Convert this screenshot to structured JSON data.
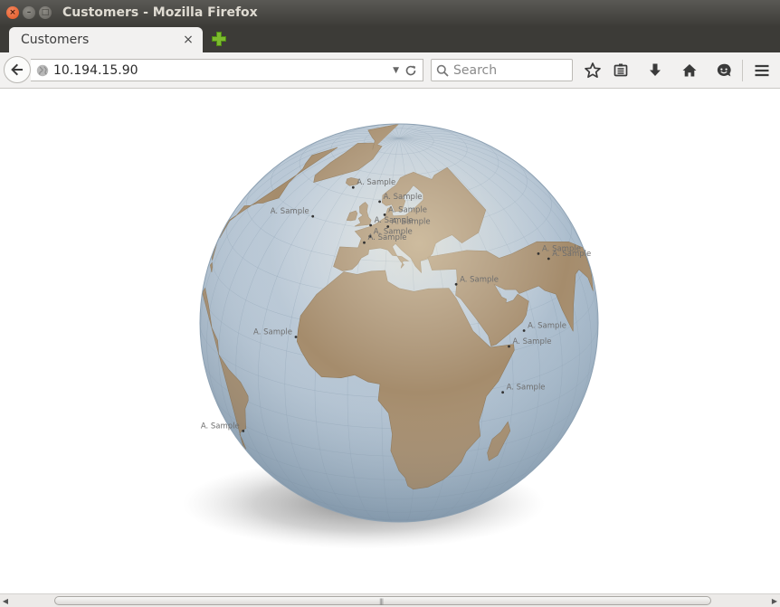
{
  "window": {
    "title": "Customers - Mozilla Firefox",
    "close_glyph": "×",
    "minimize_glyph": "–",
    "maximize_glyph": "□"
  },
  "tabs": [
    {
      "label": "Customers",
      "close_glyph": "×",
      "active": true
    }
  ],
  "navbar": {
    "url": "10.194.15.90",
    "url_dropdown_glyph": "▼",
    "search_placeholder": "Search",
    "icons": [
      "back-arrow-icon",
      "globe-icon",
      "reload-icon",
      "search-icon",
      "bookmark-star-icon",
      "reading-list-icon",
      "download-icon",
      "home-icon",
      "smiley-icon",
      "hamburger-menu-icon"
    ]
  },
  "map": {
    "type": "orthographic-globe",
    "land_color": "#a58c6c",
    "ocean_color": "#b3c4d3",
    "marker_color": "#333333",
    "markers": [
      {
        "label": "A. Sample",
        "lon": -15.6,
        "lat": 63.1
      },
      {
        "label": "A. Sample",
        "lon": -27.6,
        "lat": 50.2
      },
      {
        "label": "A. Sample",
        "lon": 4.0,
        "lat": 59.3
      },
      {
        "label": "A. Sample",
        "lon": 7.8,
        "lat": 54.8
      },
      {
        "label": "A. Sample",
        "lon": 1.9,
        "lat": 51.0
      },
      {
        "label": "A. Sample",
        "lon": 9.9,
        "lat": 50.9
      },
      {
        "label": "A. Sample",
        "lon": 2.5,
        "lat": 47.4
      },
      {
        "label": "A. Sample",
        "lon": 0.6,
        "lat": 45.3
      },
      {
        "label": "A. Sample",
        "lon": 34.8,
        "lat": 32.1
      },
      {
        "label": "A. Sample",
        "lon": 72.4,
        "lat": 33.8
      },
      {
        "label": "A. Sample",
        "lon": 76.2,
        "lat": 31.0
      },
      {
        "label": "A. Sample",
        "lon": 55.5,
        "lat": 14.8
      },
      {
        "label": "A. Sample",
        "lon": 49.3,
        "lat": 11.5
      },
      {
        "label": "A. Sample",
        "lon": 46.4,
        "lat": -1.8
      },
      {
        "label": "A. Sample",
        "lon": -17.4,
        "lat": 14.7
      },
      {
        "label": "A. Sample",
        "lon": -43.2,
        "lat": -22.9
      }
    ]
  },
  "scrollbar": {
    "left_glyph": "◀",
    "right_glyph": "▶",
    "grip_glyph": "|||"
  }
}
